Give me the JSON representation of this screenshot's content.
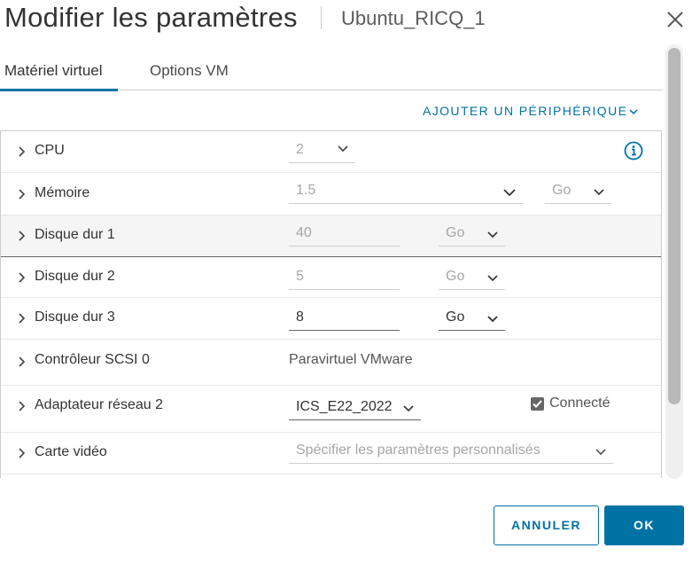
{
  "dialog": {
    "title": "Modifier les paramètres",
    "subtitle": "Ubuntu_RICQ_1"
  },
  "tabs": [
    {
      "label": "Matériel virtuel",
      "active": true
    },
    {
      "label": "Options VM",
      "active": false
    }
  ],
  "add_device_label": "AJOUTER UN PÉRIPHÉRIQUE",
  "rows": {
    "cpu": {
      "label": "CPU",
      "value": "2"
    },
    "memory": {
      "label": "Mémoire",
      "value": "1.5",
      "unit": "Go"
    },
    "disk1": {
      "label": "Disque dur 1",
      "value": "40",
      "unit": "Go"
    },
    "disk2": {
      "label": "Disque dur 2",
      "value": "5",
      "unit": "Go"
    },
    "disk3": {
      "label": "Disque dur 3",
      "value": "8",
      "unit": "Go"
    },
    "scsi": {
      "label": "Contrôleur SCSI 0",
      "value": "Paravirtuel VMware"
    },
    "net": {
      "label": "Adaptateur réseau 2",
      "value": "ICS_E22_2022",
      "connected_label": "Connecté",
      "connected": true
    },
    "video": {
      "label": "Carte vidéo",
      "value": "Spécifier les paramètres personnalisés"
    }
  },
  "buttons": {
    "cancel": "ANNULER",
    "ok": "OK"
  },
  "colors": {
    "accent": "#0072a3",
    "text": "#333333",
    "muted": "#a6a6a6"
  }
}
